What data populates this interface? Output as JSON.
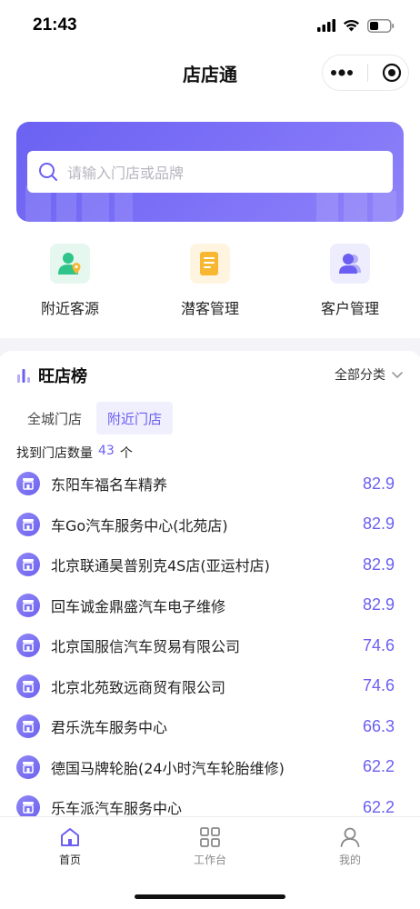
{
  "status_bar": {
    "time": "21:43"
  },
  "nav": {
    "title": "店店通"
  },
  "search": {
    "placeholder": "请输入门店或品牌"
  },
  "quick_entries": [
    {
      "label": "附近客源",
      "icon": "customer-location-icon",
      "bg": "#e6f7f0",
      "color": "#2fc48a"
    },
    {
      "label": "潜客管理",
      "icon": "document-list-icon",
      "bg": "#fff4df",
      "color": "#f7b731"
    },
    {
      "label": "客户管理",
      "icon": "users-icon",
      "bg": "#eeedfd",
      "color": "#6a5ff2"
    }
  ],
  "rank": {
    "title": "旺店榜",
    "filter": "全部分类",
    "tabs": [
      {
        "label": "全城门店",
        "active": false
      },
      {
        "label": "附近门店",
        "active": true
      }
    ],
    "count_prefix": "找到门店数量",
    "count": "43",
    "count_suffix": "个",
    "stores": [
      {
        "name": "东阳车福名车精养",
        "score": "82.9"
      },
      {
        "name": "车Go汽车服务中心(北苑店)",
        "score": "82.9"
      },
      {
        "name": "北京联通昊普别克4S店(亚运村店)",
        "score": "82.9"
      },
      {
        "name": "回车诚金鼎盛汽车电子维修",
        "score": "82.9"
      },
      {
        "name": "北京国服信汽车贸易有限公司",
        "score": "74.6"
      },
      {
        "name": "北京北苑致远商贸有限公司",
        "score": "74.6"
      },
      {
        "name": "君乐洗车服务中心",
        "score": "66.3"
      },
      {
        "name": "德国马牌轮胎(24小时汽车轮胎维修)",
        "score": "62.2"
      },
      {
        "name": "乐车派汽车服务中心",
        "score": "62.2"
      }
    ]
  },
  "tabbar": [
    {
      "label": "首页",
      "icon": "home-icon",
      "active": true
    },
    {
      "label": "工作台",
      "icon": "grid-icon",
      "active": false
    },
    {
      "label": "我的",
      "icon": "user-icon",
      "active": false
    }
  ],
  "colors": {
    "accent": "#6a5ff2",
    "hero_start": "#6b62f2",
    "hero_end": "#8f82f9"
  }
}
